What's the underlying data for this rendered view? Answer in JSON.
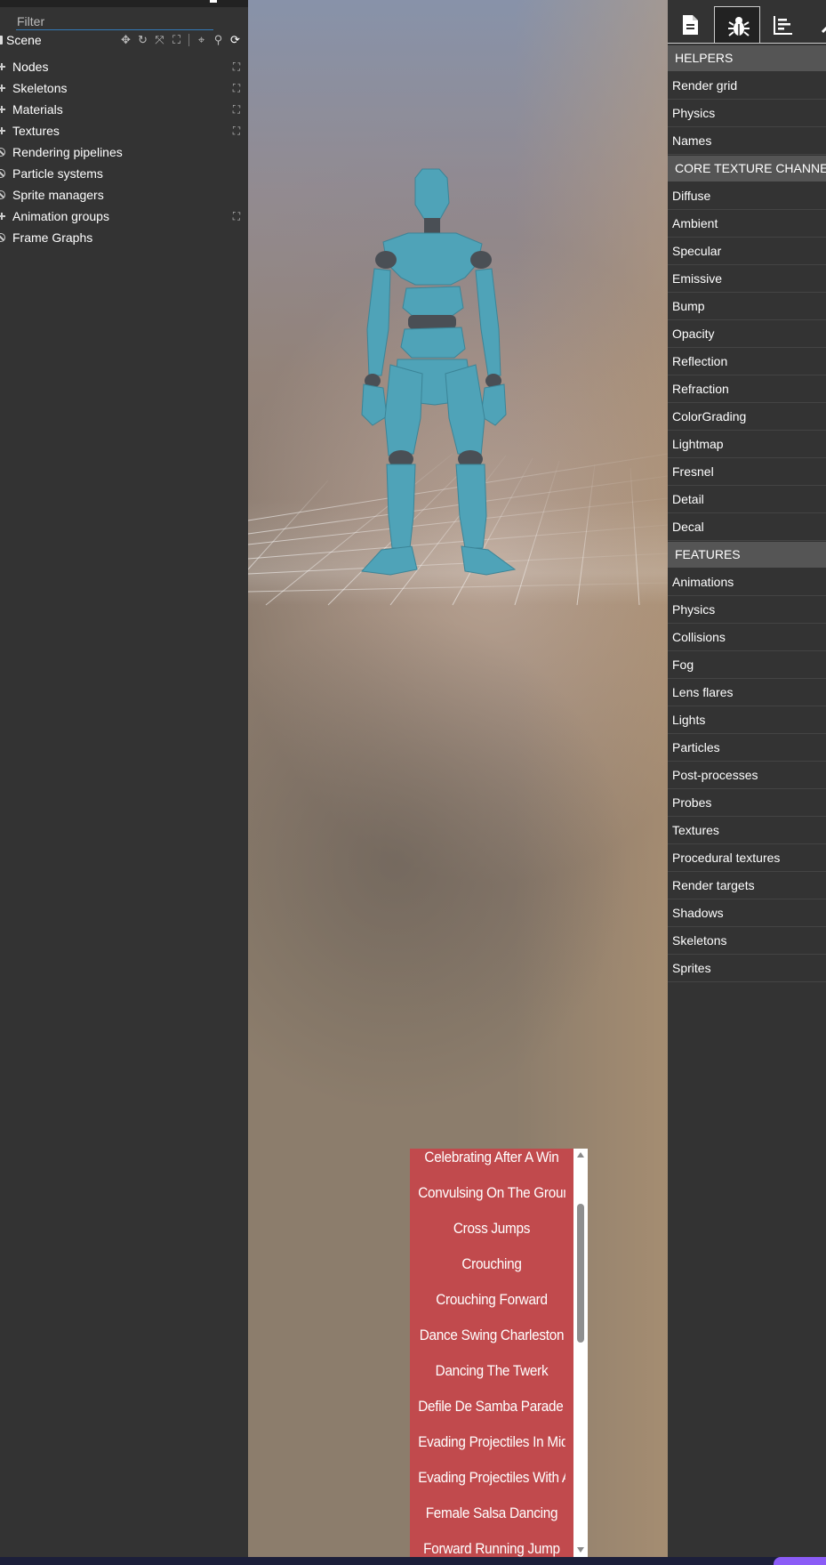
{
  "scene_explorer": {
    "filter_placeholder": "Filter",
    "scene_label": "Scene",
    "items": [
      {
        "label": "Nodes",
        "marker": "plus",
        "expandable": true
      },
      {
        "label": "Skeletons",
        "marker": "plus",
        "expandable": true
      },
      {
        "label": "Materials",
        "marker": "plus",
        "expandable": true
      },
      {
        "label": "Textures",
        "marker": "plus",
        "expandable": true
      },
      {
        "label": "Rendering pipelines",
        "marker": "ban",
        "expandable": false
      },
      {
        "label": "Particle systems",
        "marker": "ban",
        "expandable": false
      },
      {
        "label": "Sprite managers",
        "marker": "ban",
        "expandable": false
      },
      {
        "label": "Animation groups",
        "marker": "plus",
        "expandable": true
      },
      {
        "label": "Frame Graphs",
        "marker": "ban",
        "expandable": false
      }
    ]
  },
  "animation_list": {
    "items": [
      "Celebrating After A Win",
      "Convulsing On The Ground",
      "Cross Jumps",
      "Crouching",
      "Crouching Forward",
      "Dance Swing Charleston",
      "Dancing The Twerk",
      "Defile De Samba Parade Va",
      "Evading Projectiles In Mid-",
      "Evading Projectiles With A",
      "Female Salsa Dancing",
      "Forward Running Jump"
    ]
  },
  "debug_pane": {
    "tabs": [
      {
        "icon": "document-icon",
        "active": false
      },
      {
        "icon": "bug-icon",
        "active": true
      },
      {
        "icon": "chart-icon",
        "active": false
      },
      {
        "icon": "wrench-icon",
        "active": false
      }
    ],
    "sections": [
      {
        "title": "HELPERS",
        "items": [
          "Render grid",
          "Physics",
          "Names"
        ]
      },
      {
        "title": "CORE TEXTURE CHANNELS",
        "items": [
          "Diffuse",
          "Ambient",
          "Specular",
          "Emissive",
          "Bump",
          "Opacity",
          "Reflection",
          "Refraction",
          "ColorGrading",
          "Lightmap",
          "Fresnel",
          "Detail",
          "Decal"
        ]
      },
      {
        "title": "FEATURES",
        "items": [
          "Animations",
          "Physics",
          "Collisions",
          "Fog",
          "Lens flares",
          "Lights",
          "Particles",
          "Post-processes",
          "Probes",
          "Textures",
          "Procedural textures",
          "Render targets",
          "Shadows",
          "Skeletons",
          "Sprites"
        ]
      }
    ]
  },
  "colors": {
    "panel_bg": "#333333",
    "section_header_bg": "#555555",
    "anim_list_bg": "#c14a4d",
    "model_color": "#4fa3b8",
    "accent_purple": "#8b5cf6"
  }
}
